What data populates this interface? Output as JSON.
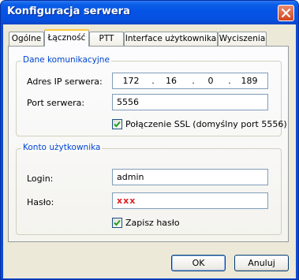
{
  "window": {
    "title": "Konfiguracja serwera"
  },
  "tabs": [
    {
      "label": "Ogólne"
    },
    {
      "label": "Łączność"
    },
    {
      "label": "PTT"
    },
    {
      "label": "Interface użytkownika"
    },
    {
      "label": "Wyciszenia"
    }
  ],
  "active_tab": "Łączność",
  "comm_group": {
    "title": "Dane komunikacyjne",
    "ip_label": "Adres IP serwera:",
    "ip": [
      "172",
      "16",
      "0",
      "189"
    ],
    "ip_separator": ".",
    "port_label": "Port serwera:",
    "port_value": "5556",
    "ssl_label": "Połączenie SSL (domyślny port 5556)",
    "ssl_checked": true
  },
  "account_group": {
    "title": "Konto użytkownika",
    "login_label": "Login:",
    "login_value": "admin",
    "password_label": "Hasło:",
    "password_value": "xxx",
    "save_password_label": "Zapisz hasło",
    "save_password_checked": true
  },
  "buttons": {
    "ok": "OK",
    "cancel": "Anuluj"
  },
  "colors": {
    "title_bar": "#0553e4",
    "group_title": "#0046d5",
    "password_text": "#e02020"
  }
}
